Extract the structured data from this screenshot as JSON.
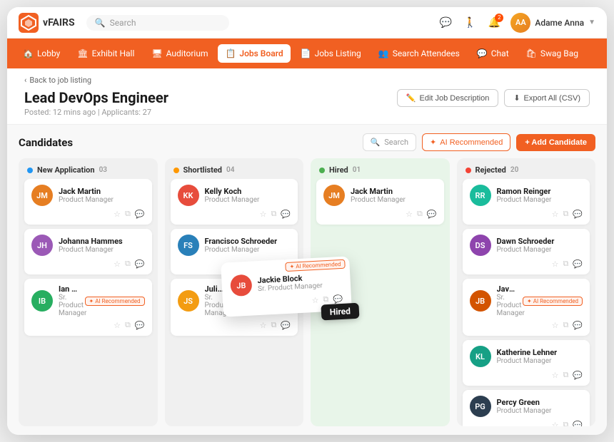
{
  "app": {
    "logo_text": "vFAIRS"
  },
  "topbar": {
    "search_placeholder": "Search",
    "user_name": "Adame Anna",
    "notification_count": "2"
  },
  "nav": {
    "items": [
      {
        "label": "Lobby",
        "icon": "🏠",
        "active": false
      },
      {
        "label": "Exhibit Hall",
        "icon": "🏛",
        "active": false
      },
      {
        "label": "Auditorium",
        "icon": "🖥",
        "active": false
      },
      {
        "label": "Jobs Board",
        "icon": "📋",
        "active": true
      },
      {
        "label": "Jobs Listing",
        "icon": "📄",
        "active": false
      },
      {
        "label": "Search Attendees",
        "icon": "👥",
        "active": false
      },
      {
        "label": "Chat",
        "icon": "💬",
        "active": false
      },
      {
        "label": "Swag Bag",
        "icon": "🛍",
        "active": false
      }
    ]
  },
  "page": {
    "back_label": "Back to job listing",
    "title": "Lead DevOps Engineer",
    "meta": "Posted: 12 mins ago  |  Applicants: 27",
    "edit_label": "Edit Job Description",
    "export_label": "Export All (CSV)"
  },
  "candidates": {
    "section_title": "Candidates",
    "search_placeholder": "Search",
    "ai_btn_label": "AI Recommended",
    "add_btn_label": "+ Add Candidate",
    "columns": [
      {
        "id": "new",
        "title": "New Application",
        "count": "03",
        "dot_color": "#2196F3",
        "cards": [
          {
            "name": "Jack Martin",
            "role": "Product Manager",
            "avatar_color": "#e67e22",
            "initials": "JM",
            "ai": false
          },
          {
            "name": "Johanna Hammes",
            "role": "Product Manager",
            "avatar_color": "#9b59b6",
            "initials": "JH",
            "ai": false
          },
          {
            "name": "Ian Beahan",
            "role": "Sr. Product Manager",
            "avatar_color": "#27ae60",
            "initials": "IB",
            "ai": true
          }
        ]
      },
      {
        "id": "shortlisted",
        "title": "Shortlisted",
        "count": "04",
        "dot_color": "#FF9800",
        "cards": [
          {
            "name": "Kelly Koch",
            "role": "Product Manager",
            "avatar_color": "#e74c3c",
            "initials": "KK",
            "ai": false
          },
          {
            "name": "Francisco Schroeder",
            "role": "Product Manager",
            "avatar_color": "#2980b9",
            "initials": "FS",
            "ai": false
          },
          {
            "name": "Julie Sanford",
            "role": "Sr. Product Manager",
            "avatar_color": "#f39c12",
            "initials": "JS",
            "ai": true
          }
        ]
      },
      {
        "id": "hired",
        "title": "Hired",
        "count": "01",
        "dot_color": "#4CAF50",
        "cards": [
          {
            "name": "Jack Martin",
            "role": "Product Manager",
            "avatar_color": "#e67e22",
            "initials": "JM",
            "ai": false
          }
        ]
      },
      {
        "id": "rejected",
        "title": "Rejected",
        "count": "20",
        "dot_color": "#F44336",
        "cards": [
          {
            "name": "Ramon Reinger",
            "role": "Product Manager",
            "avatar_color": "#1abc9c",
            "initials": "RR",
            "ai": false
          },
          {
            "name": "Dawn Schroeder",
            "role": "Product Manager",
            "avatar_color": "#8e44ad",
            "initials": "DS",
            "ai": false
          },
          {
            "name": "Javier Brekke",
            "role": "Sr. Product Manager",
            "avatar_color": "#d35400",
            "initials": "JB",
            "ai": true
          },
          {
            "name": "Katherine Lehner",
            "role": "Product Manager",
            "avatar_color": "#16a085",
            "initials": "KL",
            "ai": false
          },
          {
            "name": "Percy Green",
            "role": "Product Manager",
            "avatar_color": "#2c3e50",
            "initials": "PG",
            "ai": false
          }
        ]
      }
    ],
    "dragged_card": {
      "name": "Jackie Block",
      "role": "Sr. Product Manager",
      "avatar_color": "#e74c3c",
      "initials": "JB",
      "ai_badge": "AI Recommended",
      "hired_label": "Hired"
    }
  }
}
